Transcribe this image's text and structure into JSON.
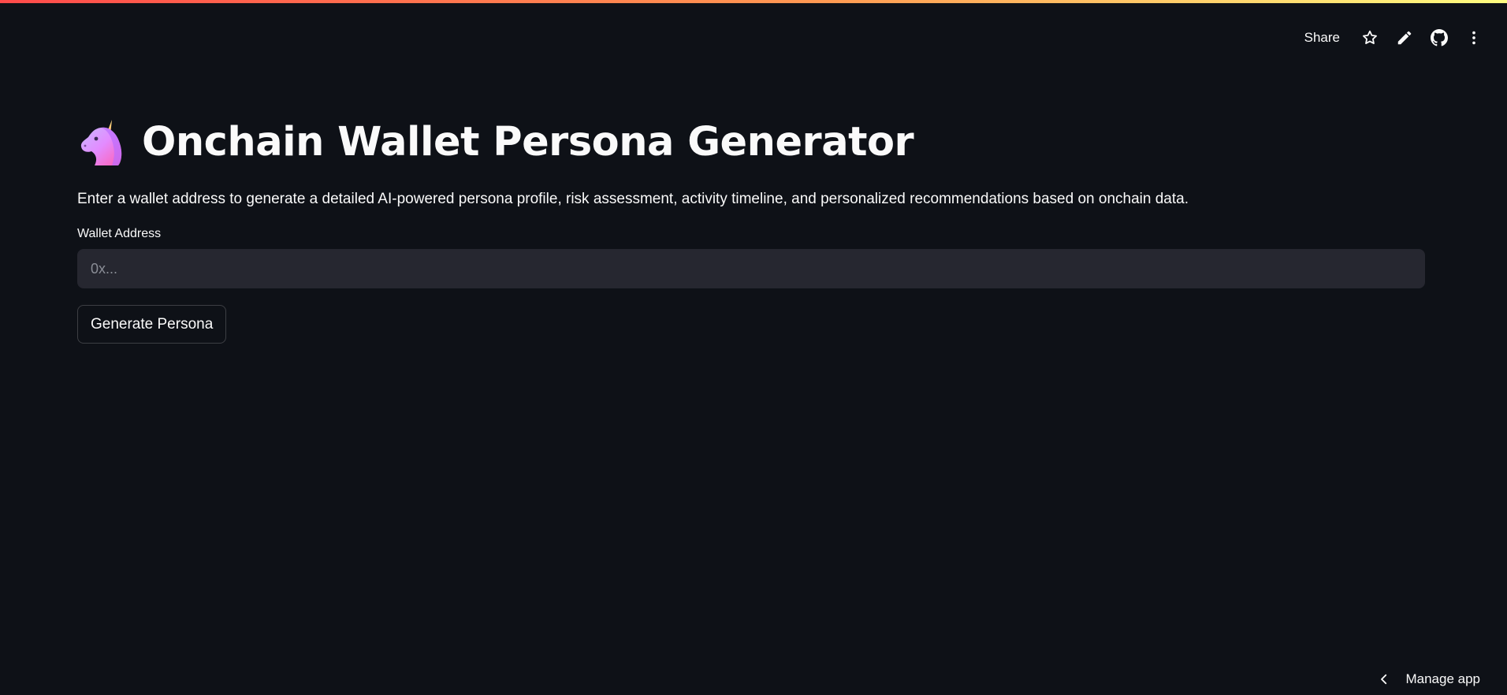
{
  "header": {
    "share_label": "Share",
    "icons": [
      "star-icon",
      "pencil-icon",
      "github-icon",
      "more-vertical-icon"
    ]
  },
  "main": {
    "emoji_icon": "unicorn-icon",
    "title": "Onchain Wallet Persona Generator",
    "description": "Enter a wallet address to generate a detailed AI-powered persona profile, risk assessment, activity timeline, and personalized recommendations based on onchain data.",
    "wallet_field": {
      "label": "Wallet Address",
      "value": "",
      "placeholder": "0x..."
    },
    "generate_button": "Generate Persona"
  },
  "footer": {
    "manage_app_label": "Manage app"
  },
  "colors": {
    "background": "#0e1117",
    "input_background": "#262730",
    "text": "#fafafa",
    "accent_gradient_start": "#ff4b4b",
    "accent_gradient_end": "#fffd80"
  }
}
